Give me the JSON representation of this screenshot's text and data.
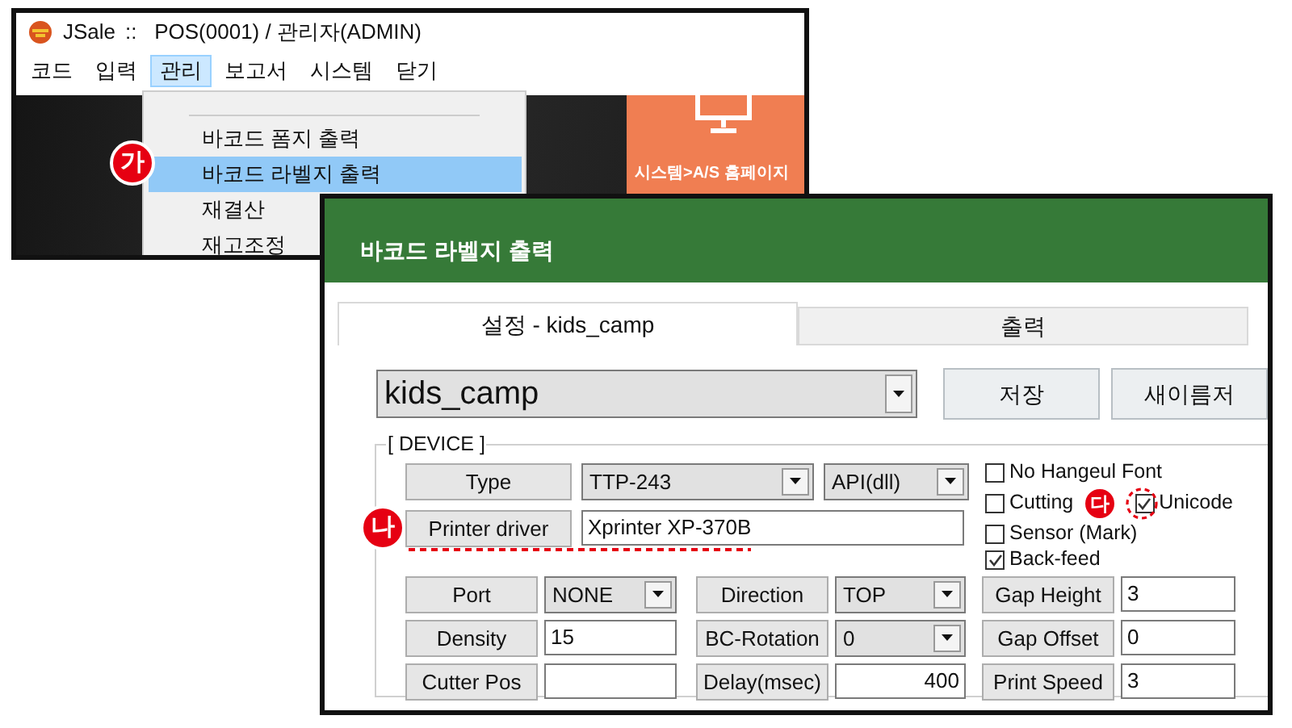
{
  "back_window": {
    "app_name": "JSale",
    "title": "::   POS(0001) / 관리자(ADMIN)",
    "menu": [
      {
        "label": "코드",
        "selected": false
      },
      {
        "label": "입력",
        "selected": false
      },
      {
        "label": "관리",
        "selected": true
      },
      {
        "label": "보고서",
        "selected": false
      },
      {
        "label": "시스템",
        "selected": false
      },
      {
        "label": "닫기",
        "selected": false
      }
    ],
    "dropdown": [
      {
        "label": "바코드 폼지 출력",
        "selected": false
      },
      {
        "label": "바코드 라벨지 출력",
        "selected": true
      },
      {
        "label": "재결산",
        "selected": false
      },
      {
        "label": "재고조정",
        "selected": false
      }
    ],
    "tile": {
      "label": "시스템>A/S 홈페이지"
    }
  },
  "dialog": {
    "title": "바코드 라벨지 출력",
    "tabs": [
      {
        "label": "설정 - kids_camp",
        "selected": true
      },
      {
        "label": "출력",
        "selected": false
      }
    ],
    "profile": {
      "value": "kids_camp"
    },
    "buttons": [
      "저장",
      "새이름저"
    ],
    "device": {
      "legend": "[ DEVICE ]",
      "type": {
        "label": "Type",
        "model": "TTP-243",
        "api": "API(dll)"
      },
      "driver": {
        "label": "Printer driver",
        "value": "Xprinter XP-370B"
      },
      "options": [
        {
          "label": "No Hangeul Font",
          "checked": false
        },
        {
          "label": "Cutting",
          "checked": false
        },
        {
          "label": "Unicode",
          "checked": true
        },
        {
          "label": "Sensor (Mark)",
          "checked": false
        },
        {
          "label": "Back-feed",
          "checked": true
        }
      ],
      "settings": [
        [
          {
            "label": "Port",
            "kind": "combo",
            "value": "NONE"
          },
          {
            "label": "Direction",
            "kind": "combo",
            "value": "TOP"
          },
          {
            "label": "Gap Height",
            "kind": "field",
            "value": "3"
          }
        ],
        [
          {
            "label": "Density",
            "kind": "field",
            "value": "15"
          },
          {
            "label": "BC-Rotation",
            "kind": "combo",
            "value": "0"
          },
          {
            "label": "Gap Offset",
            "kind": "field",
            "value": "0"
          }
        ],
        [
          {
            "label": "Cutter Pos",
            "kind": "field"
          },
          {
            "label": "Delay(msec)",
            "kind": "number",
            "value": "400"
          },
          {
            "label": "Print Speed",
            "kind": "field",
            "value": "3"
          }
        ]
      ]
    }
  },
  "annotations": [
    "가",
    "나",
    "다"
  ]
}
